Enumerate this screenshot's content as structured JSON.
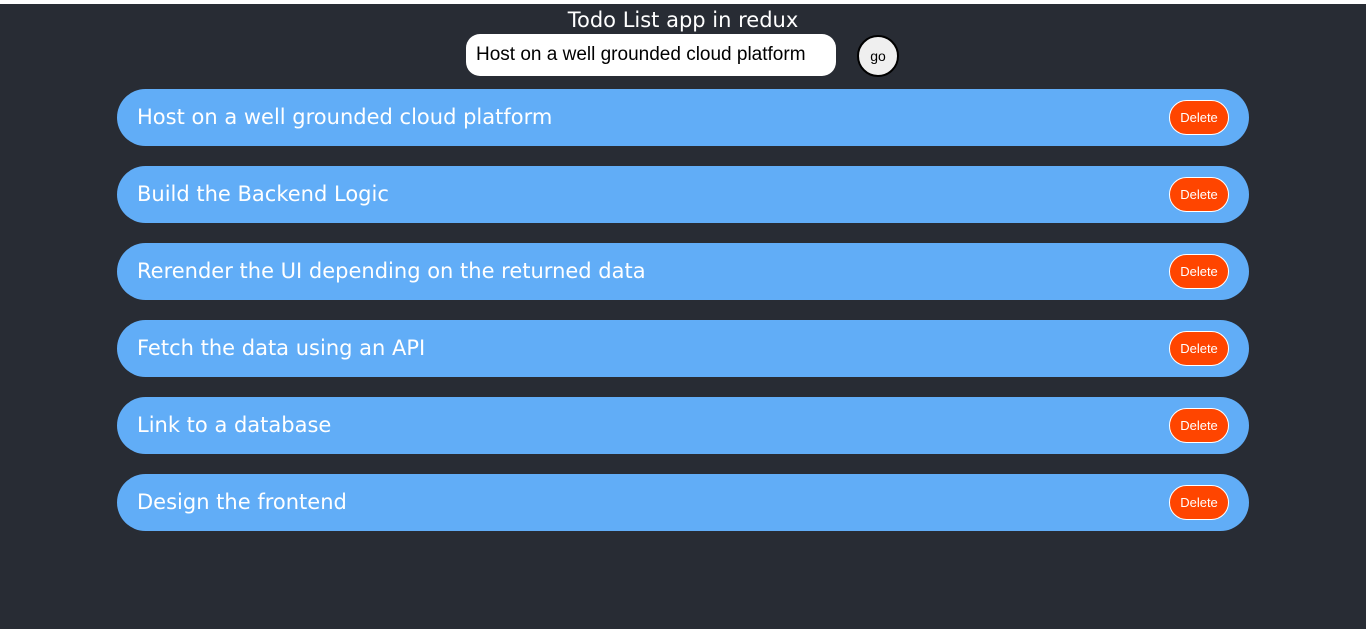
{
  "header": {
    "title": "Todo List app in redux"
  },
  "form": {
    "input_value": "Host on a well grounded cloud platform",
    "submit_label": "go"
  },
  "todos": [
    {
      "text": "Host on a well grounded cloud platform",
      "delete_label": "Delete"
    },
    {
      "text": "Build the Backend Logic",
      "delete_label": "Delete"
    },
    {
      "text": "Rerender the UI depending on the returned data",
      "delete_label": "Delete"
    },
    {
      "text": "Fetch the data using an API",
      "delete_label": "Delete"
    },
    {
      "text": "Link to a database",
      "delete_label": "Delete"
    },
    {
      "text": "Design the frontend",
      "delete_label": "Delete"
    }
  ],
  "colors": {
    "background": "#282c34",
    "item": "#61adf7",
    "delete": "#ff4500"
  }
}
